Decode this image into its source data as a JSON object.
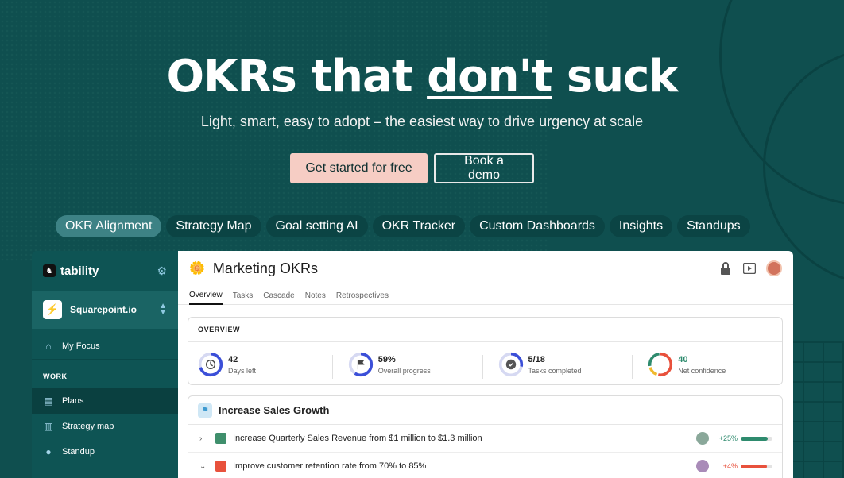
{
  "hero": {
    "title_pre": "OKRs that ",
    "title_emph": "don't",
    "title_post": " suck",
    "subtitle": "Light, smart, easy to adopt – the easiest way to drive urgency at scale",
    "cta_primary": "Get started for free",
    "cta_secondary": "Book a demo"
  },
  "tabs": [
    {
      "label": "OKR Alignment",
      "active": true
    },
    {
      "label": "Strategy Map"
    },
    {
      "label": "Goal setting AI"
    },
    {
      "label": "OKR Tracker"
    },
    {
      "label": "Custom Dashboards"
    },
    {
      "label": "Insights"
    },
    {
      "label": "Standups"
    }
  ],
  "app": {
    "brand": "tability",
    "workspace": "Squarepoint.io",
    "nav_top": {
      "label": "My Focus",
      "icon": "home-icon"
    },
    "section_work": "WORK",
    "nav_work": [
      {
        "label": "Plans",
        "icon": "document-icon",
        "active": true
      },
      {
        "label": "Strategy map",
        "icon": "columns-icon"
      },
      {
        "label": "Standup",
        "icon": "chat-icon"
      }
    ],
    "page_title": "Marketing OKRs",
    "subtabs": [
      "Overview",
      "Tasks",
      "Cascade",
      "Notes",
      "Retrospectives"
    ],
    "overview_label": "OVERVIEW",
    "stats": [
      {
        "value": "42",
        "label": "Days left",
        "icon": "clock-icon",
        "progress": 0.7,
        "color": "#3b4fd8"
      },
      {
        "value": "59%",
        "label": "Overall progress",
        "icon": "flag-icon",
        "progress": 0.59,
        "color": "#3b4fd8"
      },
      {
        "value": "5/18",
        "label": "Tasks completed",
        "icon": "check-icon",
        "progress": 0.28,
        "color": "#3b4fd8"
      },
      {
        "value": "40",
        "label": "Net confidence",
        "icon": "confidence-ring",
        "progress": 1,
        "color": "#e8513c",
        "value_color": "#2e8b6e"
      }
    ],
    "objective_title": "Increase Sales Growth",
    "key_results": [
      {
        "title": "Increase Quarterly Sales Revenue from $1 million to $1.3 million",
        "chevron": "›",
        "status_color": "#3f8f6c",
        "change": "+25%",
        "change_color": "#2e8b6e",
        "progress": 0.85,
        "bar_color": "#2e8b6e",
        "avatar_color": "#8aa89a"
      },
      {
        "title": "Improve customer retention rate from 70% to 85%",
        "chevron": "⌄",
        "status_color": "#e8513c",
        "change": "+4%",
        "change_color": "#e8513c",
        "progress": 0.82,
        "bar_color": "#e8513c",
        "avatar_color": "#a98bb8"
      }
    ]
  }
}
